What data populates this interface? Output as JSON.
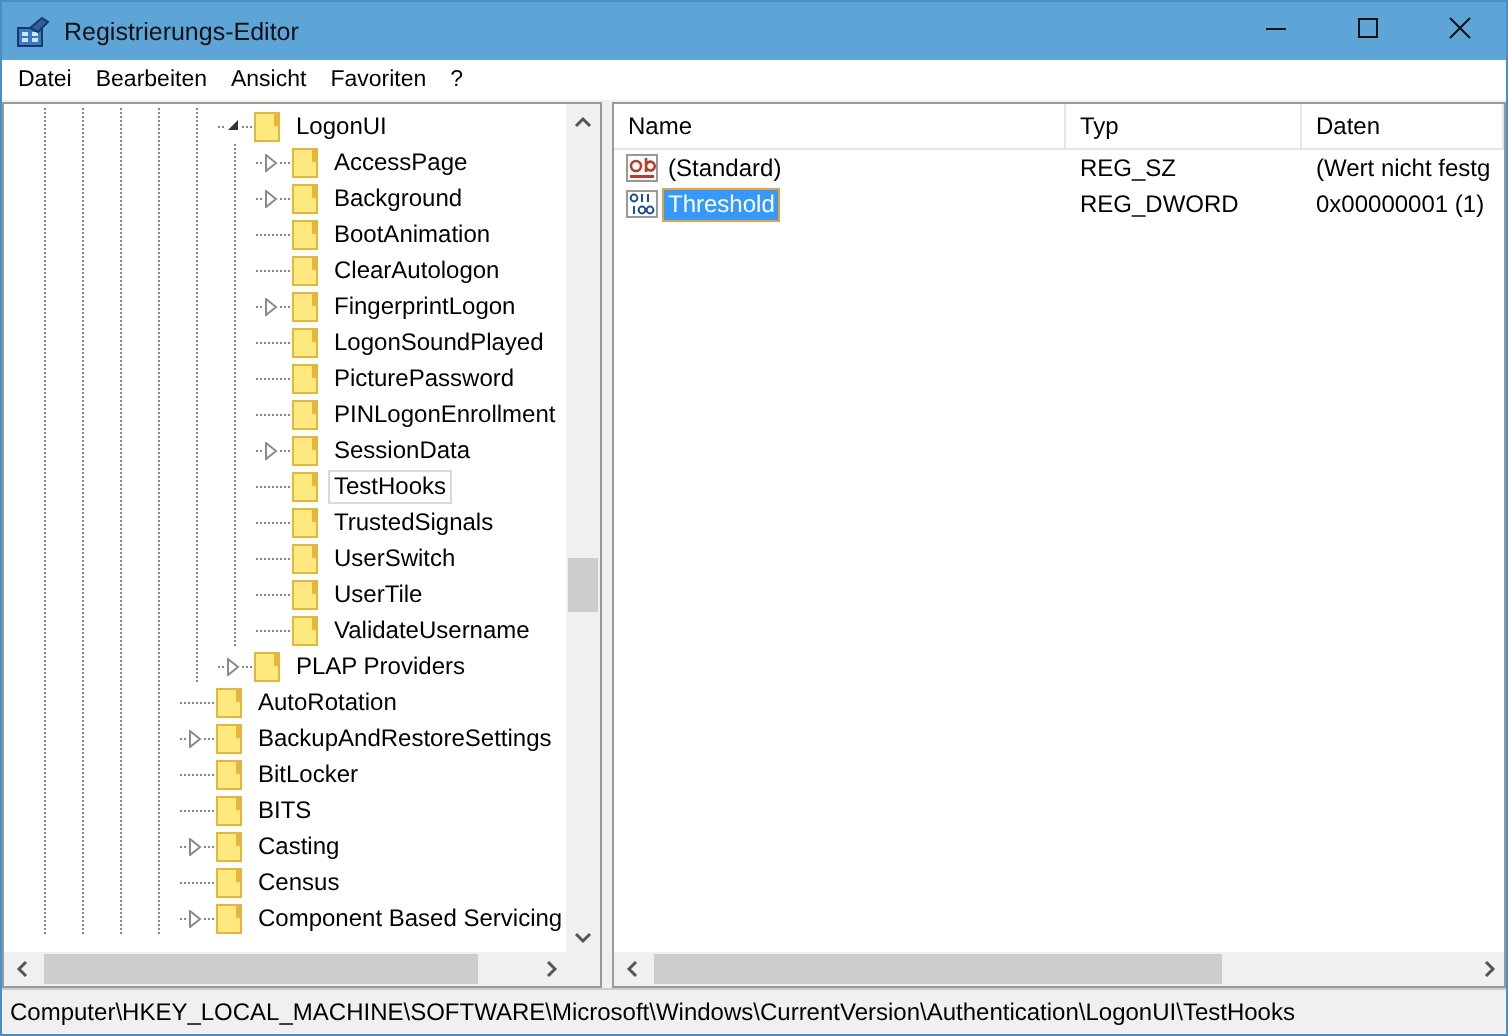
{
  "window": {
    "title": "Registrierungs-Editor"
  },
  "menu": [
    "Datei",
    "Bearbeiten",
    "Ansicht",
    "Favoriten",
    "?"
  ],
  "tree": {
    "nodes": [
      {
        "children": [
          {
            "label": "LogonUI",
            "has_children": true,
            "expanded": true,
            "selected": false,
            "children": [
              {
                "label": "AccessPage",
                "has_children": true,
                "expanded": false,
                "selected": false
              },
              {
                "label": "Background",
                "has_children": true,
                "expanded": false,
                "selected": false
              },
              {
                "label": "BootAnimation",
                "has_children": false,
                "selected": false
              },
              {
                "label": "ClearAutologon",
                "has_children": false,
                "selected": false
              },
              {
                "label": "FingerprintLogon",
                "has_children": true,
                "expanded": false,
                "selected": false
              },
              {
                "label": "LogonSoundPlayed",
                "has_children": false,
                "selected": false
              },
              {
                "label": "PicturePassword",
                "has_children": false,
                "selected": false
              },
              {
                "label": "PINLogonEnrollment",
                "has_children": false,
                "selected": false
              },
              {
                "label": "SessionData",
                "has_children": true,
                "expanded": false,
                "selected": false
              },
              {
                "label": "TestHooks",
                "has_children": false,
                "selected": true
              },
              {
                "label": "TrustedSignals",
                "has_children": false,
                "selected": false
              },
              {
                "label": "UserSwitch",
                "has_children": false,
                "selected": false
              },
              {
                "label": "UserTile",
                "has_children": false,
                "selected": false
              },
              {
                "label": "ValidateUsername",
                "has_children": false,
                "selected": false
              }
            ]
          },
          {
            "label": "PLAP Providers",
            "has_children": true,
            "expanded": false,
            "selected": false
          }
        ]
      },
      {
        "label": "AutoRotation",
        "has_children": false,
        "selected": false
      },
      {
        "label": "BackupAndRestoreSettings",
        "has_children": true,
        "expanded": false,
        "selected": false
      },
      {
        "label": "BitLocker",
        "has_children": false,
        "selected": false
      },
      {
        "label": "BITS",
        "has_children": false,
        "selected": false
      },
      {
        "label": "Casting",
        "has_children": true,
        "expanded": false,
        "selected": false
      },
      {
        "label": "Census",
        "has_children": false,
        "selected": false
      },
      {
        "label": "Component Based Servicing",
        "has_children": true,
        "expanded": false,
        "selected": false
      }
    ]
  },
  "values": {
    "columns": [
      "Name",
      "Typ",
      "Daten"
    ],
    "rows": [
      {
        "kind": "string",
        "name": "(Standard)",
        "type": "REG_SZ",
        "data": "(Wert nicht festg",
        "selected": false
      },
      {
        "kind": "dword",
        "name": "Threshold",
        "type": "REG_DWORD",
        "data": "0x00000001 (1)",
        "selected": true
      }
    ]
  },
  "status_bar": "Computer\\HKEY_LOCAL_MACHINE\\SOFTWARE\\Microsoft\\Windows\\CurrentVersion\\Authentication\\LogonUI\\TestHooks"
}
